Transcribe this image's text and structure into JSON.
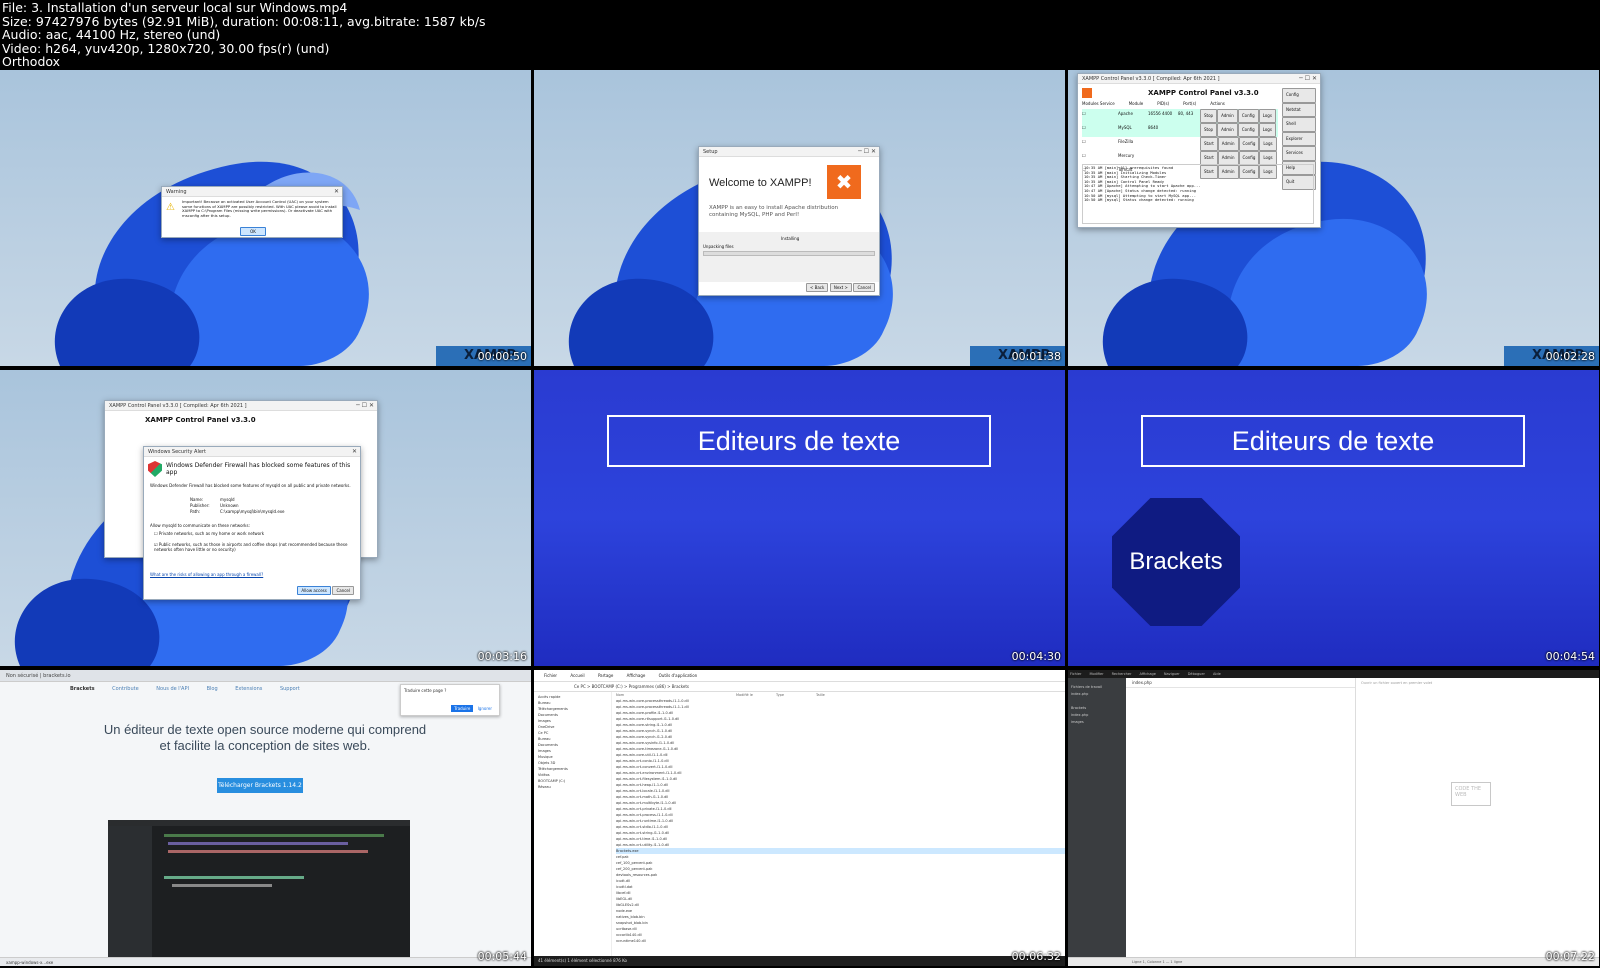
{
  "header": {
    "lines": [
      "File: 3. Installation d'un serveur local sur Windows.mp4",
      "Size: 97427976 bytes (92.91 MiB), duration: 00:08:11, avg.bitrate: 1587 kb/s",
      "Audio: aac, 44100 Hz, stereo (und)",
      "Video: h264, yuv420p, 1280x720, 30.00 fps(r) (und)",
      "Orthodox"
    ]
  },
  "tiles": [
    {
      "timestamp": "00:00:50"
    },
    {
      "timestamp": "00:01:38"
    },
    {
      "timestamp": "00:02:28"
    },
    {
      "timestamp": "00:03:16"
    },
    {
      "timestamp": "00:04:30"
    },
    {
      "timestamp": "00:04:54"
    },
    {
      "timestamp": "00:05:44"
    },
    {
      "timestamp": "00:06:32"
    },
    {
      "timestamp": "00:07:22"
    }
  ],
  "warning_dialog": {
    "title": "Warning",
    "text": "Important! Because an activated User Account Control (UAC) on your system some functions of XAMPP are possibly restricted. With UAC please avoid to install XAMPP to C:\\Program Files (missing write permissions). Or deactivate UAC with msconfig after this setup.",
    "ok_label": "OK"
  },
  "setup_dialog": {
    "title": "Setup",
    "heading": "Welcome to XAMPP!",
    "body": "XAMPP is an easy to install Apache distribution containing MySQL, PHP and Perl!",
    "installing": "Installing",
    "unpacking": "Unpacking files",
    "back": "< Back",
    "next": "Next >",
    "cancel": "Cancel"
  },
  "xampp_panel": {
    "title": "XAMPP Control Panel v3.3.0   [ Compiled: Apr 6th 2021 ]",
    "heading": "XAMPP Control Panel v3.3.0",
    "cols": [
      "Modules Service",
      "Module",
      "PID(s)",
      "Port(s)",
      "Actions"
    ],
    "modules": [
      {
        "name": "Apache",
        "pid": "16556 4400",
        "port": "80, 443",
        "action": "Stop"
      },
      {
        "name": "MySQL",
        "pid": "8640",
        "port": "",
        "action": "Stop"
      },
      {
        "name": "FileZilla",
        "pid": "",
        "port": "",
        "action": "Start"
      },
      {
        "name": "Mercury",
        "pid": "",
        "port": "",
        "action": "Start"
      },
      {
        "name": "Tomcat",
        "pid": "",
        "port": "",
        "action": "Start"
      }
    ],
    "btns": [
      "Admin",
      "Config",
      "Logs"
    ],
    "side": [
      "Config",
      "Netstat",
      "Shell",
      "Explorer",
      "Services",
      "Help",
      "Quit"
    ],
    "log": [
      "10:35 AM  [main]    All prerequisites found",
      "10:35 AM  [main]    Initializing Modules",
      "10:35 AM  [main]    Starting Check-Timer",
      "10:35 AM  [main]    Control Panel Ready",
      "10:47 AM  [Apache]  Attempting to start Apache app...",
      "10:47 AM  [Apache]  Status change detected: running",
      "10:50 AM  [mysql]   Attempting to start MySQL app...",
      "10:50 AM  [mysql]   Status change detected: running"
    ]
  },
  "firewall": {
    "window": "Windows Security Alert",
    "heading": "Windows Defender Firewall has blocked some features of this app",
    "body": "Windows Defender Firewall has blocked some features of mysqld on all public and private networks.",
    "name_label": "Name:",
    "name": "mysqld",
    "publisher_label": "Publisher:",
    "publisher": "Unknown",
    "path_label": "Path:",
    "path": "C:\\xampp\\mysql\\bin\\mysqld.exe",
    "allow_q": "Allow mysqld to communicate on these networks:",
    "private": "Private networks, such as my home or work network",
    "public": "Public networks, such as those in airports and coffee shops (not recommended because these networks often have little or no security)",
    "link": "What are the risks of allowing an app through a firewall?",
    "allow": "Allow access",
    "cancel": "Cancel"
  },
  "slides": {
    "title": "Editeurs de texte",
    "badge": "Brackets"
  },
  "brackets_site": {
    "address": "Non sécurisé | brackets.io",
    "logo": "Brackets",
    "nav": [
      "Contribute",
      "Nous de l'API",
      "Blog",
      "Extensions",
      "Support"
    ],
    "hero": "Un éditeur de texte open source moderne qui comprend et facilite la conception de sites web.",
    "download": "Télécharger Brackets 1.14.2",
    "popup_title": "Traduire cette page ?",
    "popup_btn": "Traduire",
    "popup_btn2": "Ignorer",
    "taskbar": "xampp-windows-x...exe"
  },
  "explorer": {
    "ribbon": [
      "Fichier",
      "Accueil",
      "Partage",
      "Affichage",
      "Outils d'application"
    ],
    "address": "Ce PC  >  BOOTCAMP (C:)  >  Programmes (x86)  >  Brackets",
    "cols": [
      "Nom",
      "Modifié le",
      "Type",
      "Taille"
    ],
    "side": [
      "Accès rapide",
      "Bureau",
      "Téléchargements",
      "Documents",
      "Images",
      "OneDrive",
      "Ce PC",
      "Bureau",
      "Documents",
      "Images",
      "Musique",
      "Objets 3D",
      "Téléchargements",
      "Vidéos",
      "BOOTCAMP (C:)",
      "Réseau"
    ],
    "files": [
      "api-ms-win-core-processthreads-l1-1-0.dll",
      "api-ms-win-core-processthreads-l1-1-1.dll",
      "api-ms-win-core-profile-l1-1-0.dll",
      "api-ms-win-core-rtlsupport-l1-1-0.dll",
      "api-ms-win-core-string-l1-1-0.dll",
      "api-ms-win-core-synch-l1-1-0.dll",
      "api-ms-win-core-synch-l1-2-0.dll",
      "api-ms-win-core-sysinfo-l1-1-0.dll",
      "api-ms-win-core-timezone-l1-1-0.dll",
      "api-ms-win-core-util-l1-1-0.dll",
      "api-ms-win-crt-conio-l1-1-0.dll",
      "api-ms-win-crt-convert-l1-1-0.dll",
      "api-ms-win-crt-environment-l1-1-0.dll",
      "api-ms-win-crt-filesystem-l1-1-0.dll",
      "api-ms-win-crt-heap-l1-1-0.dll",
      "api-ms-win-crt-locale-l1-1-0.dll",
      "api-ms-win-crt-math-l1-1-0.dll",
      "api-ms-win-crt-multibyte-l1-1-0.dll",
      "api-ms-win-crt-private-l1-1-0.dll",
      "api-ms-win-crt-process-l1-1-0.dll",
      "api-ms-win-crt-runtime-l1-1-0.dll",
      "api-ms-win-crt-stdio-l1-1-0.dll",
      "api-ms-win-crt-string-l1-1-0.dll",
      "api-ms-win-crt-time-l1-1-0.dll",
      "api-ms-win-crt-utility-l1-1-0.dll",
      "Brackets.exe",
      "cef.pak",
      "cef_100_percent.pak",
      "cef_200_percent.pak",
      "devtools_resources.pak",
      "icudt.dll",
      "icudtl.dat",
      "libcef.dll",
      "libEGL.dll",
      "libGLESv2.dll",
      "node.exe",
      "natives_blob.bin",
      "snapshot_blob.bin",
      "ucrtbase.dll",
      "vccorlib140.dll",
      "vcruntime140.dll"
    ],
    "selected": "Brackets.exe",
    "status": "41 élément(s)    1 élément sélectionné  876 Ko"
  },
  "brackets_app": {
    "menu": [
      "Fichier",
      "Modifier",
      "Rechercher",
      "Affichage",
      "Naviguer",
      "Déboguer",
      "Aide"
    ],
    "side": [
      "Fichiers de travail",
      "index.php",
      "",
      "Brackets",
      "index.php",
      "images"
    ],
    "tab": "index.php",
    "hint": "Ouvrir un fichier ouvert en premier volet",
    "watermark": "CODE THE WEB",
    "status": "Ligne 1, Colonne 1 — 1 ligne"
  }
}
